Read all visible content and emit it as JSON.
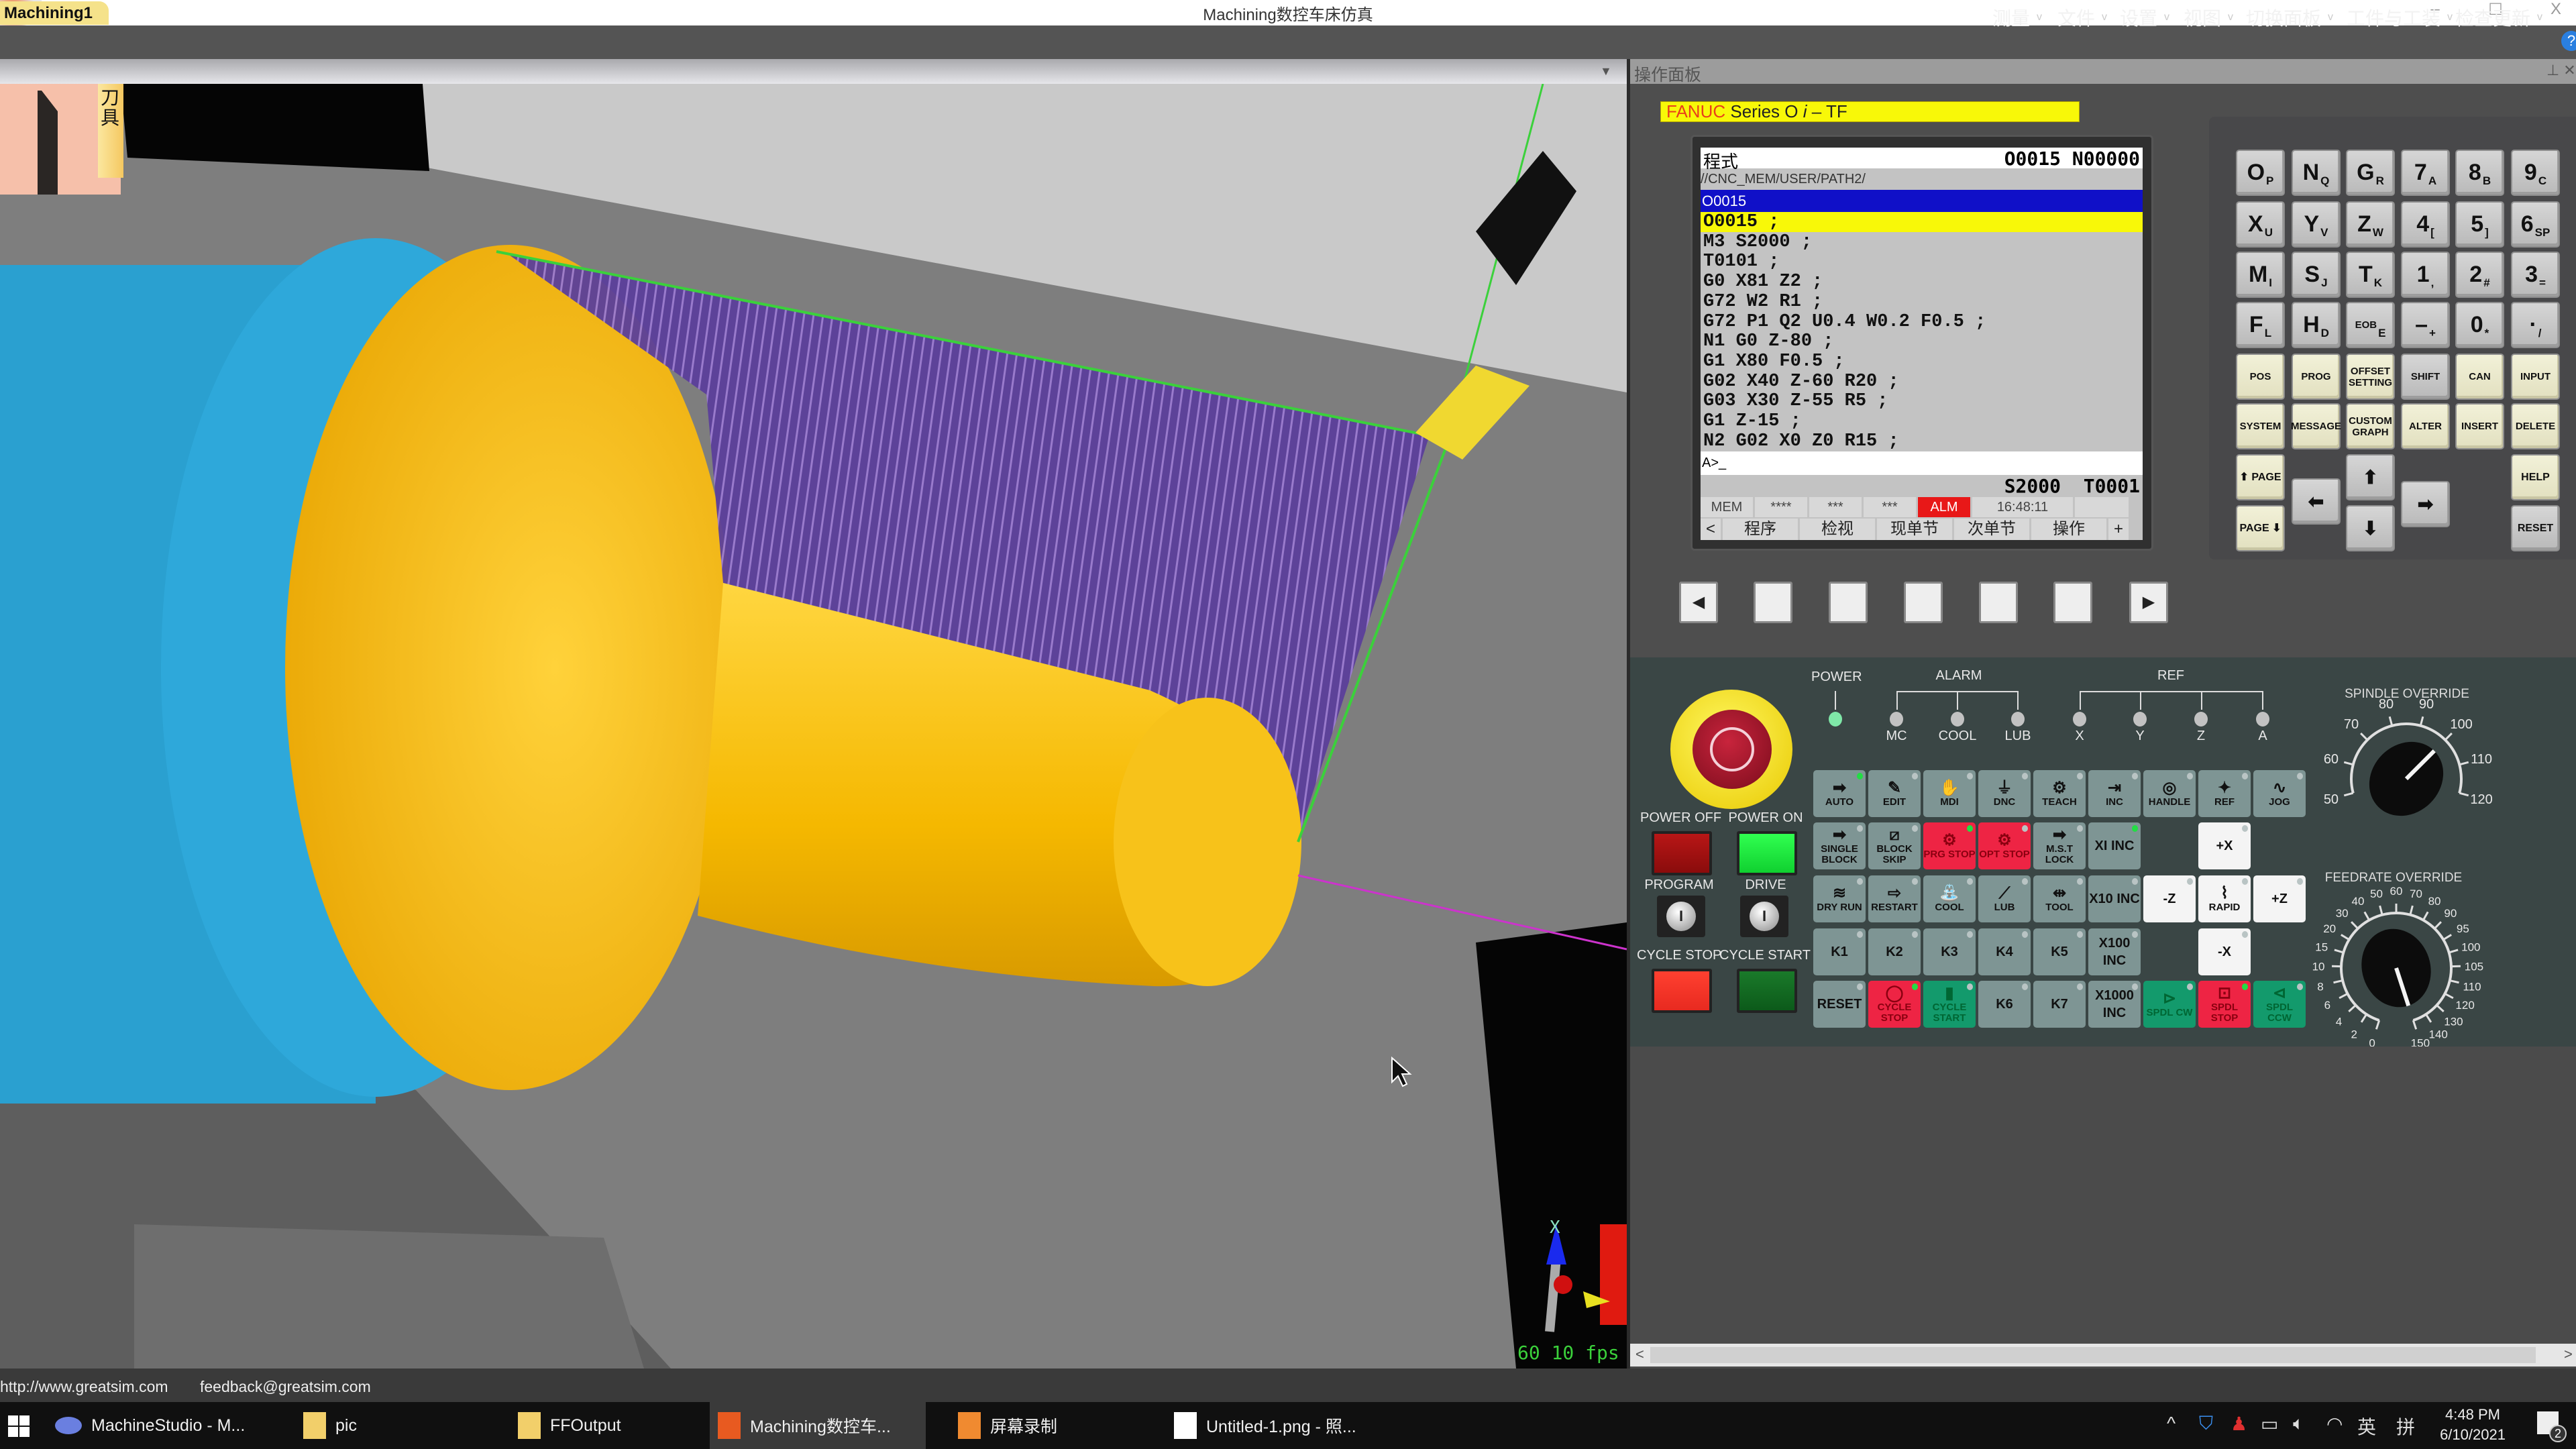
{
  "window": {
    "title": "Machining数控车床仿真",
    "controls": [
      "–",
      "☐",
      "X"
    ]
  },
  "menu": [
    "测量",
    "文件",
    "设置",
    "视图",
    "切换面板",
    "工件与工装",
    "检查更新"
  ],
  "viewport": {
    "tab": "Machining1",
    "tool_tab": "刀具",
    "fps": "60 10 fps",
    "axis_label": "X"
  },
  "right_panel": {
    "title": "操作面板"
  },
  "cnc": {
    "brand": "FANUC",
    "series": "Series O",
    "series_italic": "i",
    "series_suffix": " – TF",
    "screen_title": "程式",
    "program_no": "O0015 N00000",
    "path": "//CNC_MEM/USER/PATH2/",
    "selected_program": "O0015",
    "code_lines": [
      "O0015 ;",
      "M3 S2000 ;",
      "T0101 ;",
      "G0 X81 Z2 ;",
      "G72 W2 R1 ;",
      "G72 P1 Q2 U0.4 W0.2 F0.5 ;",
      "N1 G0 Z-80 ;",
      "G1 X80 F0.5 ;",
      "G02 X40 Z-60 R20 ;",
      "G03 X30 Z-55 R5 ;",
      "G1 Z-15 ;",
      "N2 G02 X0 Z0 R15 ;"
    ],
    "input_prompt": "A>_",
    "spindle_tool": "S2000  T0001",
    "status": [
      "MEM",
      "****",
      "***",
      "***",
      "ALM",
      "16:48:11",
      ""
    ],
    "softkeys": [
      "<",
      "程序",
      "检视",
      "现单节",
      "次单节",
      "操作",
      "+"
    ],
    "softkey_buttons": [
      "◀",
      "",
      "",
      "",
      "",
      "",
      "▶"
    ]
  },
  "keypad": [
    [
      {
        "m": "O",
        "s": "P"
      },
      {
        "m": "N",
        "s": "Q"
      },
      {
        "m": "G",
        "s": "R"
      },
      {
        "m": "7",
        "s": "A"
      },
      {
        "m": "8",
        "s": "B"
      },
      {
        "m": "9",
        "s": "C"
      }
    ],
    [
      {
        "m": "X",
        "s": "U"
      },
      {
        "m": "Y",
        "s": "V"
      },
      {
        "m": "Z",
        "s": "W"
      },
      {
        "m": "4",
        "s": "["
      },
      {
        "m": "5",
        "s": "]"
      },
      {
        "m": "6",
        "s": "SP"
      }
    ],
    [
      {
        "m": "M",
        "s": "I"
      },
      {
        "m": "S",
        "s": "J"
      },
      {
        "m": "T",
        "s": "K"
      },
      {
        "m": "1",
        "s": ","
      },
      {
        "m": "2",
        "s": "#"
      },
      {
        "m": "3",
        "s": "="
      }
    ],
    [
      {
        "m": "F",
        "s": "L"
      },
      {
        "m": "H",
        "s": "D"
      },
      {
        "w": "EOB",
        "s": "E"
      },
      {
        "m": "–",
        "s": "+"
      },
      {
        "m": "0",
        "s": "*"
      },
      {
        "m": "·",
        "s": "/"
      }
    ],
    [
      {
        "w": "POS",
        "c": 1
      },
      {
        "w": "PROG",
        "c": 1
      },
      {
        "w": "OFFSET SETTING",
        "c": 1
      },
      {
        "w": "SHIFT"
      },
      {
        "w": "CAN",
        "c": 1
      },
      {
        "w": "INPUT",
        "c": 1
      }
    ],
    [
      {
        "w": "SYSTEM",
        "c": 1
      },
      {
        "w": "MESSAGE",
        "c": 1
      },
      {
        "w": "CUSTOM GRAPH",
        "c": 1
      },
      {
        "w": "ALTER",
        "c": 1
      },
      {
        "w": "INSERT",
        "c": 1
      },
      {
        "w": "DELETE",
        "c": 1
      }
    ]
  ],
  "keypad_nav": {
    "page_up": "⬆ PAGE",
    "page_down": "PAGE ⬇",
    "left": "⬅",
    "up": "⬆",
    "down": "⬇",
    "right": "➡",
    "help": "HELP",
    "reset": "RESET"
  },
  "indicators": {
    "power": "POWER",
    "alarm": "ALARM",
    "ref": "REF",
    "alarm_items": [
      "MC",
      "COOL",
      "LUB"
    ],
    "ref_items": [
      "X",
      "Y",
      "Z",
      "A"
    ],
    "power_on": true,
    "led_on_color": "#7fe8a8",
    "led_off_color": "#c2c2c2"
  },
  "power": {
    "off": "POWER OFF",
    "on": "POWER ON",
    "program": "PROGRAM",
    "drive": "DRIVE",
    "cycle_stop": "CYCLE STOP",
    "cycle_start": "CYCLE START"
  },
  "colors": {
    "gray": "#7e9594",
    "red": "#ee2444",
    "green": "#139a6c",
    "white": "#f4f4f4",
    "led_green": "#22dd44"
  },
  "mode_buttons": [
    [
      {
        "t": "AUTO",
        "i": "➡",
        "c": "gray",
        "on": true
      },
      {
        "t": "EDIT",
        "i": "✎",
        "c": "gray"
      },
      {
        "t": "MDI",
        "i": "✋",
        "c": "gray"
      },
      {
        "t": "DNC",
        "i": "⏚",
        "c": "gray"
      },
      {
        "t": "TEACH",
        "i": "⚙",
        "c": "gray"
      },
      {
        "t": "INC",
        "i": "⇥",
        "c": "gray"
      },
      {
        "t": "HANDLE",
        "i": "◎",
        "c": "gray"
      },
      {
        "t": "REF",
        "i": "✦",
        "c": "gray"
      },
      {
        "t": "JOG",
        "i": "∿",
        "c": "gray"
      }
    ],
    [
      {
        "t": "SINGLE BLOCK",
        "i": "➡",
        "c": "gray"
      },
      {
        "t": "BLOCK SKIP",
        "i": "⧄",
        "c": "gray"
      },
      {
        "t": "PRG STOP",
        "i": "⚙",
        "c": "red",
        "on": true
      },
      {
        "t": "OPT STOP",
        "i": "⚙",
        "c": "red"
      },
      {
        "t": "M.S.T LOCK",
        "i": "➡",
        "c": "gray"
      },
      {
        "t": "XI INC",
        "c": "gray",
        "on": true
      },
      null,
      {
        "t": "+X",
        "c": "white"
      },
      null
    ],
    [
      {
        "t": "DRY RUN",
        "i": "≋",
        "c": "gray"
      },
      {
        "t": "RESTART",
        "i": "⇨",
        "c": "gray"
      },
      {
        "t": "COOL",
        "i": "⛲",
        "c": "gray"
      },
      {
        "t": "LUB",
        "i": "⟋",
        "c": "gray"
      },
      {
        "t": "TOOL",
        "i": "⇹",
        "c": "gray"
      },
      {
        "t": "X10 INC",
        "c": "gray"
      },
      {
        "t": "-Z",
        "c": "white"
      },
      {
        "t": "RAPID",
        "i": "⌇",
        "c": "white"
      },
      {
        "t": "+Z",
        "c": "white"
      }
    ],
    [
      {
        "t": "K1",
        "c": "gray"
      },
      {
        "t": "K2",
        "c": "gray"
      },
      {
        "t": "K3",
        "c": "gray"
      },
      {
        "t": "K4",
        "c": "gray"
      },
      {
        "t": "K5",
        "c": "gray"
      },
      {
        "t": "X100 INC",
        "c": "gray"
      },
      null,
      {
        "t": "-X",
        "c": "white"
      },
      null
    ],
    [
      {
        "t": "RESET",
        "c": "gray"
      },
      {
        "t": "CYCLE STOP",
        "i": "◯",
        "c": "red",
        "on": true
      },
      {
        "t": "CYCLE START",
        "i": "▮",
        "c": "green"
      },
      {
        "t": "K6",
        "c": "gray"
      },
      {
        "t": "K7",
        "c": "gray"
      },
      {
        "t": "X1000 INC",
        "c": "gray"
      },
      {
        "t": "SPDL CW",
        "i": "⊳",
        "c": "green"
      },
      {
        "t": "SPDL STOP",
        "i": "⊡",
        "c": "red",
        "on": true
      },
      {
        "t": "SPDL CCW",
        "i": "⊲",
        "c": "green"
      }
    ]
  ],
  "spindle_override": {
    "label": "SPINDLE OVERRIDE",
    "ticks": [
      "50",
      "60",
      "70",
      "80",
      "90",
      "100",
      "110",
      "120"
    ],
    "value": 100
  },
  "feedrate_override": {
    "label": "FEEDRATE OVERRIDE",
    "ticks": [
      "0",
      "2",
      "4",
      "6",
      "8",
      "10",
      "15",
      "20",
      "30",
      "40",
      "50",
      "60",
      "70",
      "80",
      "90",
      "95",
      "100",
      "105",
      "110",
      "120",
      "130",
      "140",
      "150"
    ],
    "value": 150
  },
  "statusbar": {
    "website": "http://www.greatsim.com",
    "email": "feedback@greatsim.com"
  },
  "taskbar": {
    "items": [
      "MachineStudio - M...",
      "pic",
      "FFOutput",
      "Machining数控车...",
      "屏幕录制",
      "Untitled-1.png - 照..."
    ],
    "active": 3,
    "ime1": "英",
    "ime2": "拼",
    "time": "4:48 PM",
    "date": "6/10/2021",
    "notifications": "2"
  }
}
